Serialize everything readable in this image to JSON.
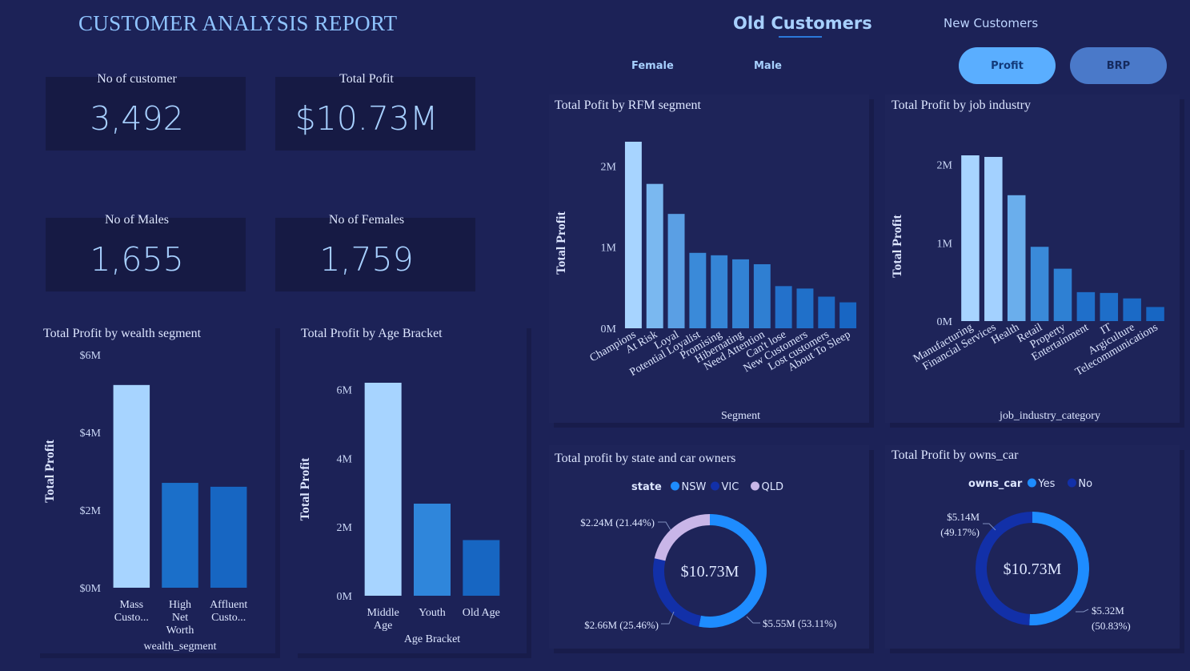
{
  "report_title": "CUSTOMER ANALYSIS REPORT",
  "tabs": {
    "old_customers": "Old Customers",
    "new_customers": "New Customers"
  },
  "filters": {
    "female": "Female",
    "male": "Male"
  },
  "buttons": {
    "profit": "Profit",
    "brp": "BRP"
  },
  "colors": {
    "background": "#1c2257",
    "accent": "#5aaeff",
    "kpi_value": "#a7d0ff"
  },
  "kpis": {
    "customers": {
      "label": "No of customer",
      "value": "3,492"
    },
    "profit": {
      "label": "Total Pofit",
      "value": "$10.73M"
    },
    "males": {
      "label": "No of Males",
      "value": "1,655"
    },
    "females": {
      "label": "No of Females",
      "value": "1,759"
    }
  },
  "chart_data": [
    {
      "id": "wealth",
      "type": "bar",
      "title": "Total Profit by wealth segment",
      "xlabel": "wealth_segment",
      "ylabel": "Total Profit",
      "categories": [
        [
          "Mass",
          "Custo..."
        ],
        [
          "High",
          "Net",
          "Worth"
        ],
        [
          "Affluent",
          "Custo..."
        ]
      ],
      "values": [
        5.22,
        2.7,
        2.6
      ],
      "ylim": [
        0,
        6
      ],
      "yticks": [
        {
          "v": 0,
          "label": "$0M"
        },
        {
          "v": 2,
          "label": "$2M"
        },
        {
          "v": 4,
          "label": "$4M"
        },
        {
          "v": 6,
          "label": "$6M"
        }
      ],
      "colors": [
        "#a7d4ff",
        "#1b6fc9",
        "#1766c2"
      ],
      "grid": false
    },
    {
      "id": "age",
      "type": "bar",
      "title": "Total Profit by Age Bracket",
      "xlabel": "Age Bracket",
      "ylabel": "Total Profit",
      "categories": [
        [
          "Middle",
          "Age"
        ],
        [
          "Youth"
        ],
        [
          "Old Age"
        ]
      ],
      "values": [
        6.2,
        2.68,
        1.62
      ],
      "ylim": [
        0,
        6.2
      ],
      "yticks": [
        {
          "v": 0,
          "label": "0M"
        },
        {
          "v": 2,
          "label": "2M"
        },
        {
          "v": 4,
          "label": "4M"
        },
        {
          "v": 6,
          "label": "6M"
        }
      ],
      "colors": [
        "#a7d4ff",
        "#2f86db",
        "#1766c2"
      ],
      "grid": false
    },
    {
      "id": "rfm",
      "type": "bar",
      "title": "Total Pofit by RFM segment",
      "xlabel": "Segment",
      "ylabel": "Total Profit",
      "categories": [
        "Champions",
        "At Risk",
        "Loyal",
        "Potential Loyalist",
        "Promising",
        "Hibernating",
        "Need Attention",
        "Can't lose",
        "New Customers",
        "Lost customers",
        "About To Sleep"
      ],
      "values": [
        2.3,
        1.78,
        1.41,
        0.93,
        0.9,
        0.85,
        0.79,
        0.52,
        0.49,
        0.39,
        0.32
      ],
      "ylim": [
        0,
        2.3
      ],
      "yticks": [
        {
          "v": 0,
          "label": "0M"
        },
        {
          "v": 1,
          "label": "1M"
        },
        {
          "v": 2,
          "label": "2M"
        }
      ],
      "colors": [
        "#a7d4ff",
        "#7ab8f0",
        "#5a9fe4",
        "#3a8ad9",
        "#3585d6",
        "#3282d4",
        "#2f7fd2",
        "#2371cb",
        "#2070c9",
        "#1c6ac6",
        "#1866c3"
      ],
      "grid": false
    },
    {
      "id": "industry",
      "type": "bar",
      "title": "Total Profit by job industry",
      "xlabel": "job_industry_category",
      "ylabel": "Total Profit",
      "categories": [
        "Manufacturing",
        "Financial Services",
        "Health",
        "Retail",
        "Property",
        "Entertainment",
        "IT",
        "Argiculture",
        "Telecommunications"
      ],
      "values": [
        2.12,
        2.1,
        1.61,
        0.95,
        0.67,
        0.37,
        0.36,
        0.29,
        0.18
      ],
      "ylim": [
        0,
        2.12
      ],
      "yticks": [
        {
          "v": 0,
          "label": "0M"
        },
        {
          "v": 1,
          "label": "1M"
        },
        {
          "v": 2,
          "label": "2M"
        }
      ],
      "colors": [
        "#a7d4ff",
        "#a3d1ff",
        "#6aaeec",
        "#3a8ad9",
        "#2e80d3",
        "#1f6fca",
        "#1e6ec9",
        "#1b6ac6",
        "#1766c3"
      ],
      "grid": false
    },
    {
      "id": "state",
      "type": "pie",
      "donut": true,
      "title": "Total profit by state and car owners",
      "legend_title": "state",
      "center_label": "$10.73M",
      "legend_position": "top",
      "series": [
        {
          "name": "NSW",
          "value": 5.55,
          "label": "$5.55M (53.11%)",
          "color": "#1e8cff"
        },
        {
          "name": "VIC",
          "value": 2.66,
          "label": "$2.66M (25.46%)",
          "color": "#1230a8"
        },
        {
          "name": "QLD",
          "value": 2.24,
          "label": "$2.24M (21.44%)",
          "color": "#c9b6e8"
        }
      ]
    },
    {
      "id": "car",
      "type": "pie",
      "donut": true,
      "title": "Total Profit by owns_car",
      "legend_title": "owns_car",
      "center_label": "$10.73M",
      "legend_position": "top",
      "series": [
        {
          "name": "Yes",
          "value": 5.32,
          "label": "$5.32M\n(50.83%)",
          "color": "#1e8cff"
        },
        {
          "name": "No",
          "value": 5.14,
          "label": "$5.14M\n(49.17%)",
          "color": "#1230a8"
        }
      ]
    }
  ]
}
